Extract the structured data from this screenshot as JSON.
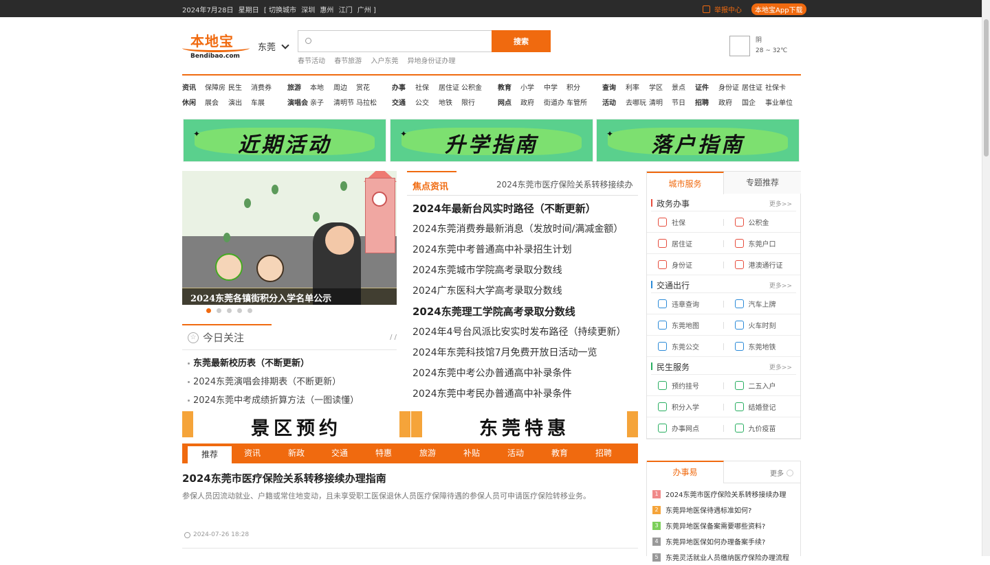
{
  "topbar": {
    "date": "2024年7月28日",
    "weekday": "星期日",
    "switch_open": "[ 切换城市",
    "cities": [
      "深圳",
      "惠州",
      "江门"
    ],
    "last_city": "广州 ]",
    "report": "举报中心",
    "app_download": "本地宝App下载"
  },
  "header": {
    "logo_text": "本地宝",
    "logo_sub": "Bendibao.com",
    "city": "东莞",
    "search_button": "搜索",
    "search_placeholder": "",
    "hotwords": [
      "春节活动",
      "春节旅游",
      "入户东莞",
      "异地身份证办理"
    ],
    "weather": {
      "condition": "阴",
      "temp": "28 ~ 32℃"
    }
  },
  "nav": {
    "r1": [
      {
        "t": "资讯",
        "b": true
      },
      {
        "t": "保障房"
      },
      {
        "t": "民生"
      },
      {
        "t": "消费券"
      },
      {
        "t": "旅游",
        "b": true
      },
      {
        "t": "本地"
      },
      {
        "t": "周边"
      },
      {
        "t": "赏花"
      },
      {
        "t": "办事",
        "b": true
      },
      {
        "t": "社保"
      },
      {
        "t": "居住证"
      },
      {
        "t": "公积金"
      },
      {
        "t": "教育",
        "b": true
      },
      {
        "t": "小学"
      },
      {
        "t": "中学"
      },
      {
        "t": "积分"
      },
      {
        "t": "查询",
        "b": true
      },
      {
        "t": "利率"
      },
      {
        "t": "学区"
      },
      {
        "t": "景点"
      },
      {
        "t": "证件",
        "b": true
      },
      {
        "t": "身份证"
      },
      {
        "t": "居住证"
      },
      {
        "t": "社保卡"
      }
    ],
    "r2": [
      {
        "t": "休闲",
        "b": true
      },
      {
        "t": "展会"
      },
      {
        "t": "演出"
      },
      {
        "t": "车展"
      },
      {
        "t": "演唱会",
        "b": true
      },
      {
        "t": "亲子"
      },
      {
        "t": "清明节"
      },
      {
        "t": "马拉松"
      },
      {
        "t": "交通",
        "b": true
      },
      {
        "t": "公交"
      },
      {
        "t": "地铁"
      },
      {
        "t": "限行"
      },
      {
        "t": "网点",
        "b": true
      },
      {
        "t": "政府"
      },
      {
        "t": "街道办"
      },
      {
        "t": "车管所"
      },
      {
        "t": "活动",
        "b": true
      },
      {
        "t": "去哪玩"
      },
      {
        "t": "清明"
      },
      {
        "t": "节日"
      },
      {
        "t": "招聘",
        "b": true
      },
      {
        "t": "政府"
      },
      {
        "t": "国企"
      },
      {
        "t": "事业单位"
      }
    ]
  },
  "banners": [
    "近期活动",
    "升学指南",
    "落户指南"
  ],
  "slider": {
    "caption": "2024东莞各镇街积分入学名单公示"
  },
  "today": {
    "title": "今日关注",
    "more": "/ /",
    "items": [
      "东莞最新校历表（不断更新）",
      "2024东莞演唱会排期表（不断更新）",
      "2024东莞中考成绩折算方法（一图读懂）"
    ]
  },
  "focus": {
    "tab": "焦点资讯",
    "marquee": "2024东莞市医疗保险关系转移接续办",
    "items": [
      {
        "t": "2024年最新台风实时路径（不断更新）",
        "b": true
      },
      {
        "t": "2024东莞消费券最新消息（发放时间/满减金额）"
      },
      {
        "t": "2024东莞中考普通高中补录招生计划"
      },
      {
        "t": "2024东莞城市学院高考录取分数线"
      },
      {
        "t": "2024广东医科大学高考录取分数线"
      },
      {
        "t": "2024东莞理工学院高考录取分数线",
        "b": true
      },
      {
        "t": "2024年4号台风派比安实时发布路径（持续更新）"
      },
      {
        "t": "2024年东莞科技馆7月免费开放日活动一览"
      },
      {
        "t": "2024东莞中考公办普通高中补录条件"
      },
      {
        "t": "2024东莞中考民办普通高中补录条件"
      }
    ]
  },
  "ads": [
    "景区预约",
    "东莞特惠"
  ],
  "tabs": [
    "推荐",
    "资讯",
    "新政",
    "交通",
    "特惠",
    "旅游",
    "补贴",
    "活动",
    "教育",
    "招聘"
  ],
  "article": {
    "title": "2024东莞市医疗保险关系转移接续办理指南",
    "summary": "参保人员因流动就业、户籍或常住地变动，且未享受职工医保退休人员医疗保障待遇的参保人员可申请医疗保险转移业务。",
    "time": "2024-07-26 18:28"
  },
  "panel": {
    "tab_active": "城市服务",
    "tab_other": "专题推荐",
    "more": "更多>>",
    "sections": [
      {
        "title": "政务办事",
        "color": "#e74c3c",
        "items": [
          [
            "社保",
            "#e74c3c"
          ],
          [
            "公积金",
            "#e74c3c"
          ],
          [
            "居住证",
            "#e74c3c"
          ],
          [
            "东莞户口",
            "#e74c3c"
          ],
          [
            "身份证",
            "#e74c3c"
          ],
          [
            "港澳通行证",
            "#e74c3c"
          ]
        ]
      },
      {
        "title": "交通出行",
        "color": "#2a8ad8",
        "items": [
          [
            "违章查询",
            "#2a8ad8"
          ],
          [
            "汽车上牌",
            "#2a8ad8"
          ],
          [
            "东莞地图",
            "#2a8ad8"
          ],
          [
            "火车时刻",
            "#2a8ad8"
          ],
          [
            "东莞公交",
            "#2a8ad8"
          ],
          [
            "东莞地铁",
            "#2a8ad8"
          ]
        ]
      },
      {
        "title": "民生服务",
        "color": "#27ae60",
        "items": [
          [
            "预约挂号",
            "#27ae60"
          ],
          [
            "二五入户",
            "#27ae60"
          ],
          [
            "积分入学",
            "#27ae60"
          ],
          [
            "结婚登记",
            "#27ae60"
          ],
          [
            "办事网点",
            "#27ae60"
          ],
          [
            "九价疫苗",
            "#27ae60"
          ]
        ]
      }
    ]
  },
  "panel2": {
    "title": "办事易",
    "more": "更多",
    "items": [
      {
        "t": "2024东莞市医疗保险关系转移接续办理",
        "c": "#f08a8a"
      },
      {
        "t": "东莞异地医保待遇标准如何?",
        "c": "#f5a43a"
      },
      {
        "t": "东莞异地医保备案需要哪些资料?",
        "c": "#7ccf5a"
      },
      {
        "t": "东莞异地医保如何办理备案手续?",
        "c": "#999999"
      },
      {
        "t": "东莞灵活就业人员缴纳医疗保险办理流程",
        "c": "#999999"
      }
    ]
  }
}
